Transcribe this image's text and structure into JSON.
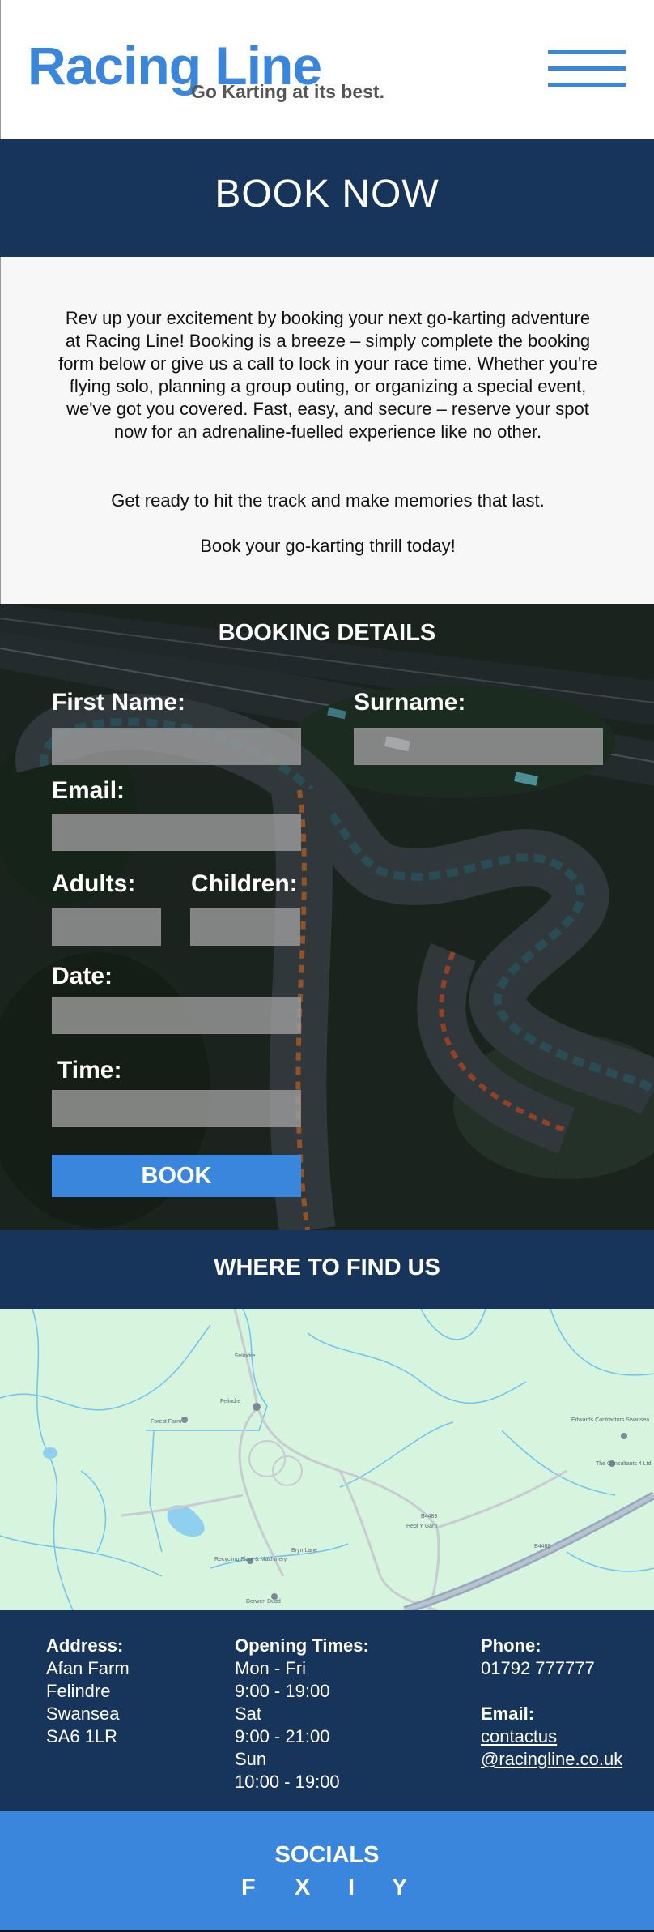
{
  "header": {
    "logo": "Racing Line",
    "tagline": "Go Karting at its best."
  },
  "banner": {
    "title": "BOOK NOW"
  },
  "intro": {
    "p1": "Rev up your excitement by booking your next go-karting adventure at Racing Line! Booking is a breeze – simply complete the booking form below or give us a call to lock in your race time. Whether you're flying solo, planning a group outing, or organizing a special event, we've got you covered. Fast, easy, and secure – reserve your spot now for an adrenaline-fuelled experience like no other.",
    "p2": "Get ready to hit the track and make memories that last.",
    "p3": "Book your go-karting thrill today!"
  },
  "booking": {
    "title": "BOOKING DETAILS",
    "first_name_label": "First Name:",
    "surname_label": "Surname:",
    "email_label": "Email:",
    "adults_label": "Adults:",
    "children_label": "Children:",
    "date_label": "Date:",
    "time_label": "Time:",
    "first_name_value": "",
    "surname_value": "",
    "email_value": "",
    "adults_value": "",
    "children_value": "",
    "date_value": "",
    "time_value": "",
    "button": "BOOK"
  },
  "findus": {
    "title": "WHERE TO FIND US"
  },
  "map": {
    "labels": [
      "Felindre",
      "Forest Farm",
      "Edwards Contractors Swansea",
      "The Consultants 4 Ltd",
      "Recycling Plant & Machinery",
      "Derwen Dudd",
      "Bryn Lane",
      "B4489",
      "B4489",
      "Heol Y Garn",
      "Felindre"
    ]
  },
  "info": {
    "address_heading": "Address:",
    "address_lines": [
      "Afan Farm",
      "Felindre",
      "Swansea",
      "SA6 1LR"
    ],
    "hours_heading": "Opening Times:",
    "hours_lines": [
      "Mon - Fri",
      "9:00 - 19:00",
      "Sat",
      "9:00 - 21:00",
      "Sun",
      "10:00 - 19:00"
    ],
    "phone_heading": "Phone:",
    "phone": "01792 777777",
    "email_heading": "Email:",
    "email_line1": "contactus",
    "email_line2": "@racingline.co.uk"
  },
  "socials": {
    "title": "SOCIALS",
    "links": [
      "F",
      "X",
      "I",
      "Y"
    ]
  },
  "colors": {
    "brand_blue": "#3a86dc",
    "navy": "#17345b",
    "map_green": "#d6f4de"
  },
  "icons": {
    "menu": "hamburger-menu-icon"
  }
}
